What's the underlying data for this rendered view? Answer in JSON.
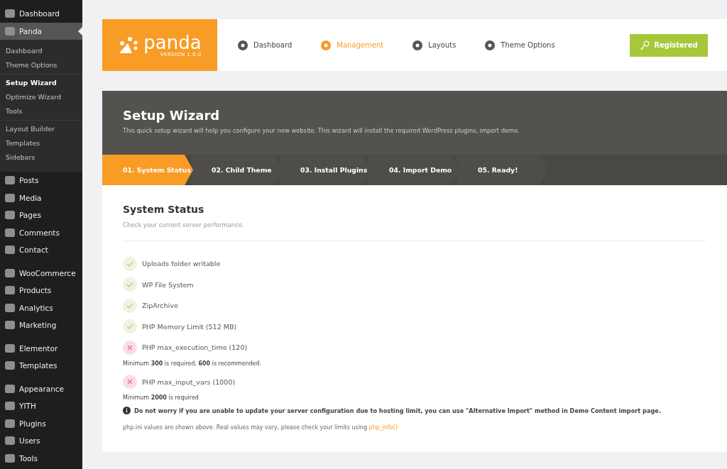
{
  "sidebar": {
    "groups": [
      {
        "items": [
          {
            "label": "Dashboard",
            "selected": false
          },
          {
            "label": "Panda",
            "selected": true,
            "submenu": [
              [
                {
                  "label": "Dashboard",
                  "selected": false
                },
                {
                  "label": "Theme Options",
                  "selected": false
                }
              ],
              [
                {
                  "label": "Setup Wizard",
                  "selected": true
                },
                {
                  "label": "Optimize Wizard",
                  "selected": false
                },
                {
                  "label": "Tools",
                  "selected": false
                }
              ],
              [
                {
                  "label": "Layout Builder",
                  "selected": false
                },
                {
                  "label": "Templates",
                  "selected": false
                },
                {
                  "label": "Sidebars",
                  "selected": false
                }
              ]
            ]
          },
          {
            "label": "Posts",
            "selected": false
          },
          {
            "label": "Media",
            "selected": false
          },
          {
            "label": "Pages",
            "selected": false
          },
          {
            "label": "Comments",
            "selected": false
          },
          {
            "label": "Contact",
            "selected": false
          }
        ]
      },
      {
        "items": [
          {
            "label": "WooCommerce",
            "selected": false
          },
          {
            "label": "Products",
            "selected": false
          },
          {
            "label": "Analytics",
            "selected": false
          },
          {
            "label": "Marketing",
            "selected": false
          }
        ]
      },
      {
        "items": [
          {
            "label": "Elementor",
            "selected": false
          },
          {
            "label": "Templates",
            "selected": false
          }
        ]
      },
      {
        "items": [
          {
            "label": "Appearance",
            "selected": false
          },
          {
            "label": "YITH",
            "selected": false
          },
          {
            "label": "Plugins",
            "selected": false
          },
          {
            "label": "Users",
            "selected": false
          },
          {
            "label": "Tools",
            "selected": false
          }
        ]
      }
    ]
  },
  "logo": {
    "name": "panda",
    "version": "VERSION 1.0.0"
  },
  "nav": [
    {
      "label": "Dashboard",
      "selected": false
    },
    {
      "label": "Management",
      "selected": true
    },
    {
      "label": "Layouts",
      "selected": false
    },
    {
      "label": "Theme Options",
      "selected": false
    }
  ],
  "register_button": "Registered",
  "wizard": {
    "title": "Setup Wizard",
    "subtitle": "This quick setup wizard will help you configure your new website. This wizard will install the required WordPress plugins, import demo.",
    "steps": [
      {
        "label": "01. System Status",
        "selected": true
      },
      {
        "label": "02. Child Theme",
        "selected": false
      },
      {
        "label": "03. Install Plugins",
        "selected": false
      },
      {
        "label": "04. Import Demo",
        "selected": false
      },
      {
        "label": "05. Ready!",
        "selected": false
      }
    ]
  },
  "status": {
    "title": "System Status",
    "subtitle": "Check your current server performance.",
    "checks": [
      {
        "label": "Uploads folder writable",
        "ok": true
      },
      {
        "label": "WP File System",
        "ok": true
      },
      {
        "label": "ZipArchive",
        "ok": true
      },
      {
        "label": "PHP Memory Limit (512 MB)",
        "ok": true
      },
      {
        "label": "PHP max_execution_time (120)",
        "ok": false,
        "note": "Minimum **300** is required, **600** is recommended."
      },
      {
        "label": "PHP max_input_vars (1000)",
        "ok": false,
        "note": "Minimum **2000** is required"
      }
    ],
    "info": "Do not worry if you are unable to update your server configuration due to hosting limit, you can use \"Alternative Import\" method in Demo Content import page.",
    "footer": "php.ini values are shown above. Real values may vary, please check your limits using",
    "footer_link": "php_info()"
  }
}
